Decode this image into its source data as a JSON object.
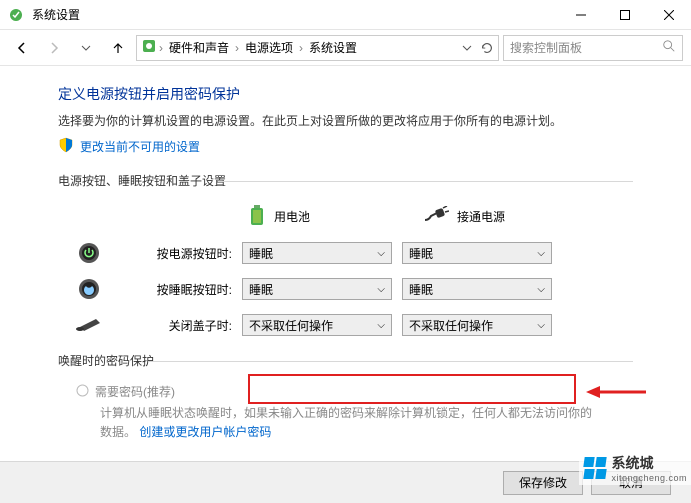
{
  "window": {
    "title": "系统设置"
  },
  "breadcrumb": {
    "seg1": "硬件和声音",
    "seg2": "电源选项",
    "seg3": "系统设置"
  },
  "search": {
    "placeholder": "搜索控制面板"
  },
  "heading": "定义电源按钮并启用密码保护",
  "description": "选择要为你的计算机设置的电源设置。在此页上对设置所做的更改将应用于你所有的电源计划。",
  "shield_link": "更改当前不可用的设置",
  "section1": "电源按钮、睡眠按钮和盖子设置",
  "col_battery": "用电池",
  "col_plugged": "接通电源",
  "rows": {
    "power_btn": {
      "label": "按电源按钮时:",
      "battery": "睡眠",
      "plugged": "睡眠"
    },
    "sleep_btn": {
      "label": "按睡眠按钮时:",
      "battery": "睡眠",
      "plugged": "睡眠"
    },
    "lid": {
      "label": "关闭盖子时:",
      "battery": "不采取任何操作",
      "plugged": "不采取任何操作"
    }
  },
  "section2": "唤醒时的密码保护",
  "pwd": {
    "radio1": "需要密码(推荐)",
    "desc": "计算机从睡眠状态唤醒时，如果未输入正确的密码来解除计算机锁定，任何人都无法访问你的数据。",
    "link": "创建或更改用户帐户密码"
  },
  "buttons": {
    "save": "保存修改",
    "cancel": "取消"
  },
  "watermark": {
    "name": "系统城",
    "domain": "xitongcheng.com"
  }
}
